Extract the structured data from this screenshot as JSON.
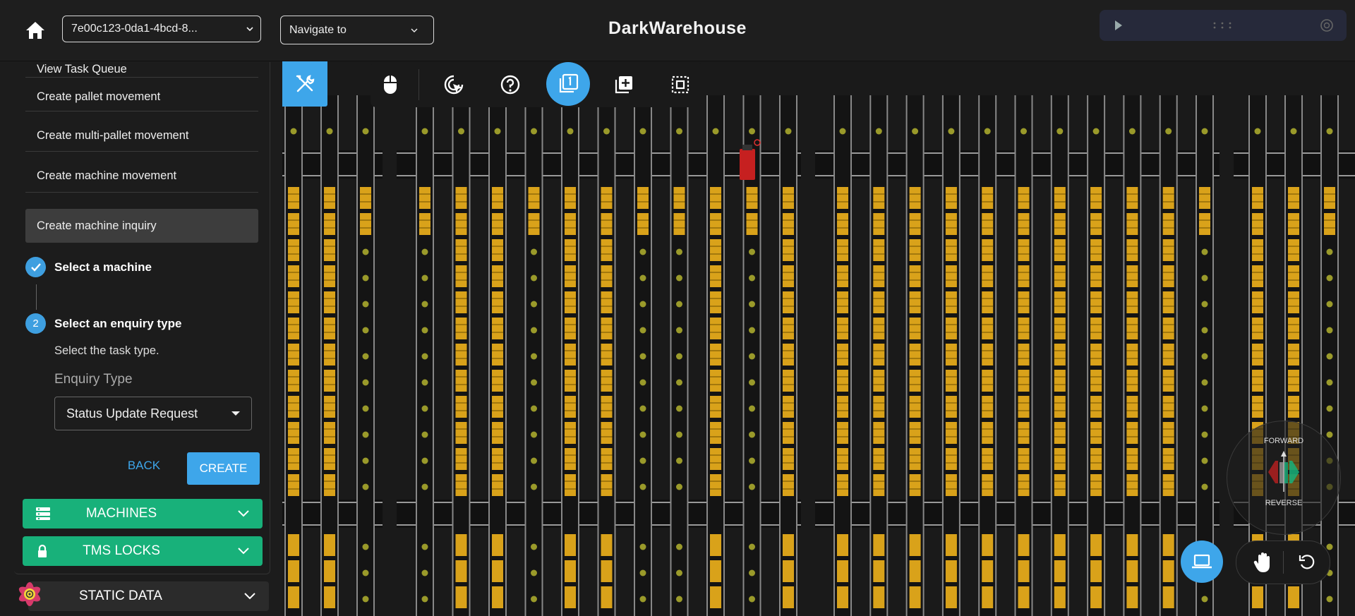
{
  "header": {
    "title": "DarkWarehouse",
    "session_id": "7e00c123-0da1-4bcd-8...",
    "navigate_placeholder": "Navigate to"
  },
  "menu": {
    "items": [
      {
        "label": "View Task Queue"
      },
      {
        "label": "Create pallet movement"
      },
      {
        "label": "Create multi-pallet movement"
      },
      {
        "label": "Create machine movement"
      },
      {
        "label": "Create machine inquiry"
      }
    ]
  },
  "stepper": {
    "step1": {
      "label": "Select a machine"
    },
    "step2": {
      "number": "2",
      "label": "Select an enquiry type",
      "hint": "Select the task type."
    },
    "enquiry_label": "Enquiry Type",
    "enquiry_value": "Status Update Request"
  },
  "actions": {
    "back": "BACK",
    "create": "CREATE"
  },
  "accordions": {
    "machines": "MACHINES",
    "tms_locks": "TMS LOCKS",
    "static_data": "STATIC DATA"
  },
  "direction": {
    "forward": "FORWARD",
    "reverse": "REVERSE"
  },
  "colors": {
    "accent": "#3ea6ea",
    "green": "#18b17a",
    "pallet": "#d9a21a",
    "machine": "#c62020"
  }
}
